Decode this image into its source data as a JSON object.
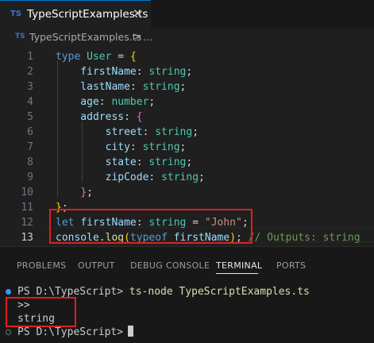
{
  "tab": {
    "badge": "TS",
    "title": "TypeScriptExamples.ts",
    "close": "✕"
  },
  "breadcrumb": {
    "badge": "TS",
    "file": "TypeScriptExamples.ts",
    "separator": ">",
    "more": "..."
  },
  "editor": {
    "line_numbers": [
      "1",
      "2",
      "3",
      "4",
      "5",
      "6",
      "7",
      "8",
      "9",
      "10",
      "11",
      "12",
      "13"
    ],
    "active_line": "13",
    "lines": [
      [
        {
          "t": "type ",
          "c": "kw"
        },
        {
          "t": "User",
          "c": "ty"
        },
        {
          "t": " = ",
          "c": "pl"
        },
        {
          "t": "{",
          "c": "br1"
        }
      ],
      [
        {
          "t": "    firstName",
          "c": "pr"
        },
        {
          "t": ": ",
          "c": "pl"
        },
        {
          "t": "string",
          "c": "ty"
        },
        {
          "t": ";",
          "c": "pl"
        }
      ],
      [
        {
          "t": "    lastName",
          "c": "pr"
        },
        {
          "t": ": ",
          "c": "pl"
        },
        {
          "t": "string",
          "c": "ty"
        },
        {
          "t": ";",
          "c": "pl"
        }
      ],
      [
        {
          "t": "    age",
          "c": "pr"
        },
        {
          "t": ": ",
          "c": "pl"
        },
        {
          "t": "number",
          "c": "ty"
        },
        {
          "t": ";",
          "c": "pl"
        }
      ],
      [
        {
          "t": "    address",
          "c": "pr"
        },
        {
          "t": ": ",
          "c": "pl"
        },
        {
          "t": "{",
          "c": "br2"
        }
      ],
      [
        {
          "t": "        street",
          "c": "pr"
        },
        {
          "t": ": ",
          "c": "pl"
        },
        {
          "t": "string",
          "c": "ty"
        },
        {
          "t": ";",
          "c": "pl"
        }
      ],
      [
        {
          "t": "        city",
          "c": "pr"
        },
        {
          "t": ": ",
          "c": "pl"
        },
        {
          "t": "string",
          "c": "ty"
        },
        {
          "t": ";",
          "c": "pl"
        }
      ],
      [
        {
          "t": "        state",
          "c": "pr"
        },
        {
          "t": ": ",
          "c": "pl"
        },
        {
          "t": "string",
          "c": "ty"
        },
        {
          "t": ";",
          "c": "pl"
        }
      ],
      [
        {
          "t": "        zipCode",
          "c": "pr"
        },
        {
          "t": ": ",
          "c": "pl"
        },
        {
          "t": "string",
          "c": "ty"
        },
        {
          "t": ";",
          "c": "pl"
        }
      ],
      [
        {
          "t": "    ",
          "c": "pl"
        },
        {
          "t": "}",
          "c": "br2"
        },
        {
          "t": ";",
          "c": "pl"
        }
      ],
      [
        {
          "t": "}",
          "c": "br1"
        },
        {
          "t": ";",
          "c": "pl"
        }
      ],
      [
        {
          "t": "let ",
          "c": "kw"
        },
        {
          "t": "firstName",
          "c": "pr"
        },
        {
          "t": ": ",
          "c": "pl"
        },
        {
          "t": "string",
          "c": "ty"
        },
        {
          "t": " = ",
          "c": "pl"
        },
        {
          "t": "\"John\"",
          "c": "str"
        },
        {
          "t": ";",
          "c": "pl"
        }
      ],
      [
        {
          "t": "console",
          "c": "pr"
        },
        {
          "t": ".",
          "c": "pl"
        },
        {
          "t": "log",
          "c": "fn"
        },
        {
          "t": "(",
          "c": "br1"
        },
        {
          "t": "typeof ",
          "c": "kw"
        },
        {
          "t": "firstName",
          "c": "pr"
        },
        {
          "t": ")",
          "c": "br1"
        },
        {
          "t": "; ",
          "c": "pl"
        },
        {
          "t": "// Outputs: string",
          "c": "cm"
        }
      ]
    ]
  },
  "panel": {
    "tabs": [
      "PROBLEMS",
      "OUTPUT",
      "DEBUG CONSOLE",
      "TERMINAL",
      "PORTS"
    ],
    "active_tab": "TERMINAL"
  },
  "terminal": {
    "prompt1": "PS D:\\TypeScript> ",
    "command": "ts-node TypeScriptExamples.ts",
    "output1": ">>",
    "output2": "string",
    "prompt2": "PS D:\\TypeScript>"
  },
  "colors": {
    "accent": "#0078d4",
    "highlight_box": "#e01e1e",
    "dot_success": "#3794ff",
    "dot_idle": "#6e7681"
  }
}
